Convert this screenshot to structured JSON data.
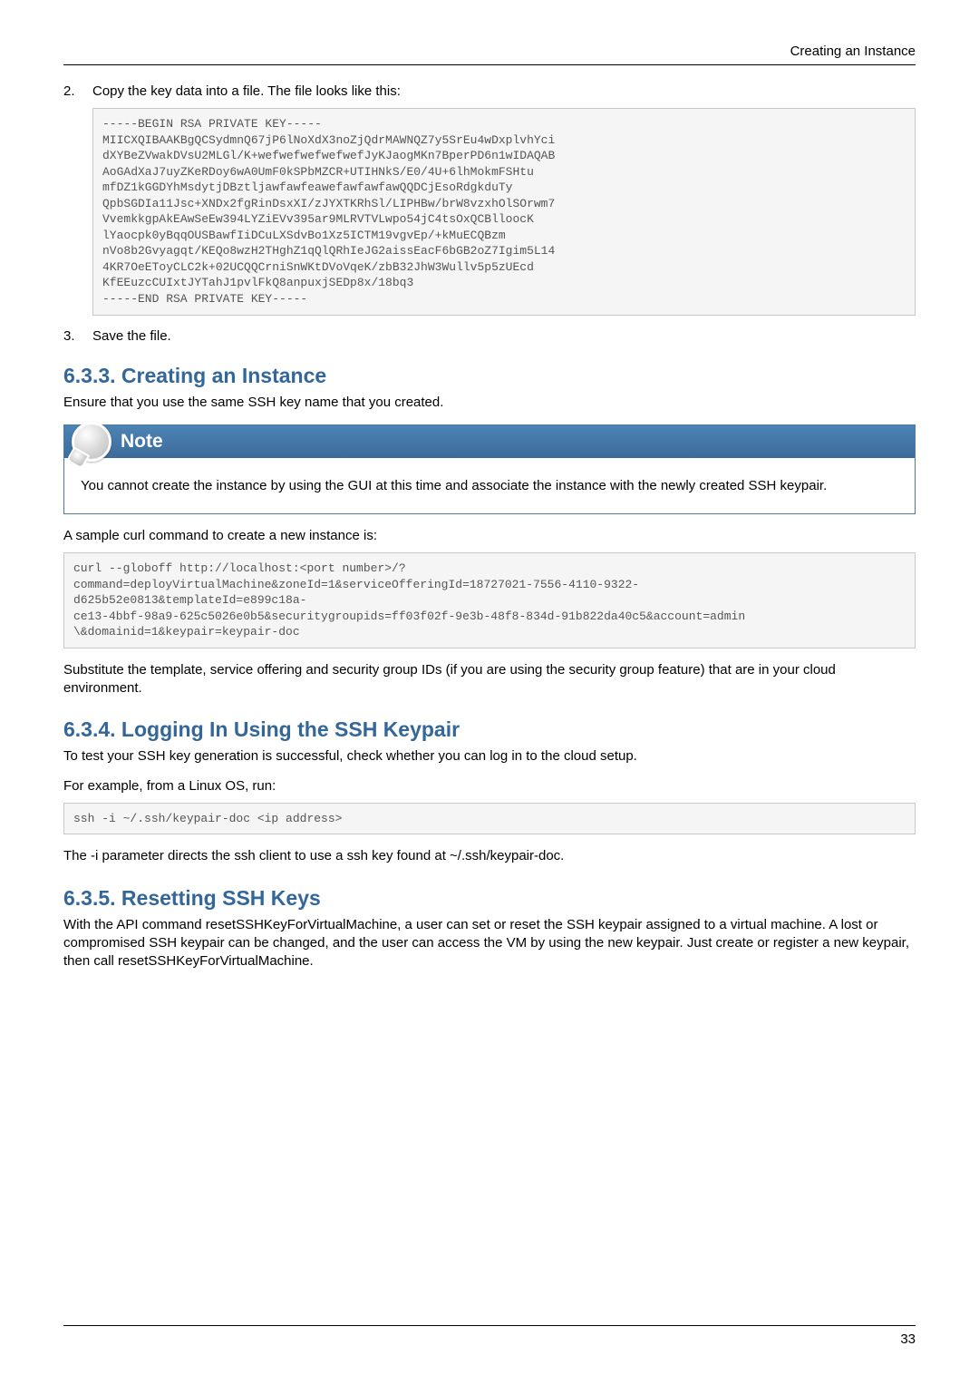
{
  "header": {
    "running_title": "Creating an Instance"
  },
  "steps": {
    "s2": {
      "num": "2.",
      "text": "Copy the key data into a file. The file looks like this:"
    },
    "s3": {
      "num": "3.",
      "text": "Save the file."
    }
  },
  "key_block": "-----BEGIN RSA PRIVATE KEY-----\nMIICXQIBAAKBgQCSydmnQ67jP6lNoXdX3noZjQdrMAWNQZ7y5SrEu4wDxplvhYci\ndXYBeZVwakDVsU2MLGl/K+wefwefwefwefwefJyKJaogMKn7BperPD6n1wIDAQAB\nAoGAdXaJ7uyZKeRDoy6wA0UmF0kSPbMZCR+UTIHNkS/E0/4U+6lhMokmFSHtu\nmfDZ1kGGDYhMsdytjDBztljawfawfeawefawfawfawQQDCjEsoRdgkduTy\nQpbSGDIa11Jsc+XNDx2fgRinDsxXI/zJYXTKRhSl/LIPHBw/brW8vzxhOlSOrwm7\nVvemkkgpAkEAwSeEw394LYZiEVv395ar9MLRVTVLwpo54jC4tsOxQCBlloocK\nlYaocpk0yBqqOUSBawfIiDCuLXSdvBo1Xz5ICTM19vgvEp/+kMuECQBzm\nnVo8b2Gvyagqt/KEQo8wzH2THghZ1qQlQRhIeJG2aissEacF6bGB2oZ7Igim5L14\n4KR7OeEToyCLC2k+02UCQQCrniSnWKtDVoVqeK/zbB32JhW3Wullv5p5zUEcd\nKfEEuzcCUIxtJYTahJ1pvlFkQ8anpuxjSEDp8x/18bq3\n-----END RSA PRIVATE KEY-----",
  "sec633": {
    "title": "6.3.3. Creating an Instance",
    "intro": "Ensure that you use the same SSH key name that you created.",
    "note_title": "Note",
    "note_body": "You cannot create the instance by using the GUI at this time and associate the instance with the newly created SSH keypair.",
    "sample_intro": "A sample curl command to create a new instance is:",
    "curl_block": "curl --globoff http://localhost:<port number>/?\ncommand=deployVirtualMachine&zoneId=1&serviceOfferingId=18727021-7556-4110-9322-\nd625b52e0813&templateId=e899c18a-\nce13-4bbf-98a9-625c5026e0b5&securitygroupids=ff03f02f-9e3b-48f8-834d-91b822da40c5&account=admin\n\\&domainid=1&keypair=keypair-doc",
    "subst": "Substitute the template, service offering and security group IDs (if you are using the security group feature) that are in your cloud environment."
  },
  "sec634": {
    "title": "6.3.4. Logging In Using the SSH Keypair",
    "p1": "To test your SSH key generation is successful, check whether you can log in to the cloud setup.",
    "p2": "For example, from a Linux OS, run:",
    "ssh_block": "ssh -i ~/.ssh/keypair-doc <ip address>",
    "p3": "The -i parameter directs the ssh client to use a ssh key found at ~/.ssh/keypair-doc."
  },
  "sec635": {
    "title": "6.3.5. Resetting SSH Keys",
    "p1": "With the API command resetSSHKeyForVirtualMachine, a user can set or reset the SSH keypair assigned to a virtual machine. A lost or compromised SSH keypair can be changed, and the user can access the VM by using the new keypair. Just create or register a new keypair, then call resetSSHKeyForVirtualMachine."
  },
  "footer": {
    "page": "33"
  }
}
